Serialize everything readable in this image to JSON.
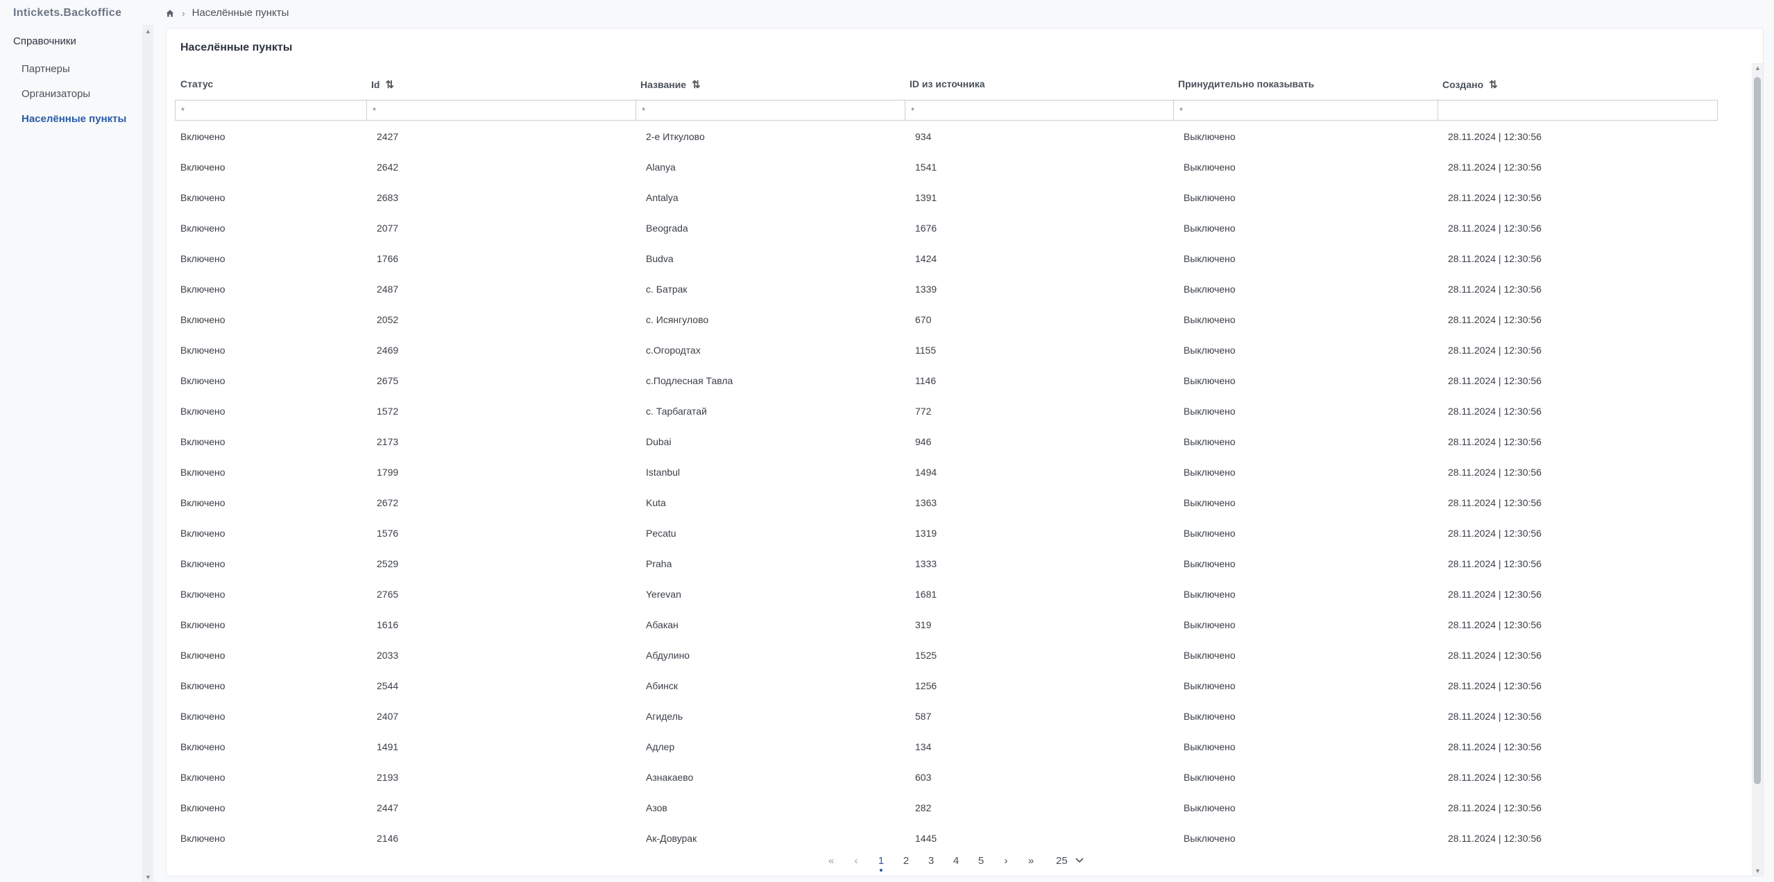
{
  "app": {
    "logo": "Intickets.Backoffice"
  },
  "breadcrumb": {
    "current": "Населённые пункты"
  },
  "sidebar": {
    "group": "Справочники",
    "items": [
      {
        "label": "Партнеры",
        "active": false
      },
      {
        "label": "Организаторы",
        "active": false
      },
      {
        "label": "Населённые пункты",
        "active": true
      }
    ]
  },
  "page": {
    "title": "Населённые пункты"
  },
  "table": {
    "columns": [
      {
        "label": "Статус",
        "sortable": false
      },
      {
        "label": "Id",
        "sortable": true
      },
      {
        "label": "Название",
        "sortable": true
      },
      {
        "label": "ID из источника",
        "sortable": false
      },
      {
        "label": "Принудительно показывать",
        "sortable": false
      },
      {
        "label": "Создано",
        "sortable": true
      }
    ],
    "filters": [
      {
        "placeholder": "*"
      },
      {
        "placeholder": "*"
      },
      {
        "placeholder": "*"
      },
      {
        "placeholder": "*"
      },
      {
        "placeholder": "*"
      },
      {
        "placeholder": ""
      }
    ],
    "rows": [
      [
        "Включено",
        "2427",
        "2-е Иткулово",
        "934",
        "Выключено",
        "28.11.2024 | 12:30:56"
      ],
      [
        "Включено",
        "2642",
        "Alanya",
        "1541",
        "Выключено",
        "28.11.2024 | 12:30:56"
      ],
      [
        "Включено",
        "2683",
        "Antalya",
        "1391",
        "Выключено",
        "28.11.2024 | 12:30:56"
      ],
      [
        "Включено",
        "2077",
        "Beograda",
        "1676",
        "Выключено",
        "28.11.2024 | 12:30:56"
      ],
      [
        "Включено",
        "1766",
        "Budva",
        "1424",
        "Выключено",
        "28.11.2024 | 12:30:56"
      ],
      [
        "Включено",
        "2487",
        "с. Батрак",
        "1339",
        "Выключено",
        "28.11.2024 | 12:30:56"
      ],
      [
        "Включено",
        "2052",
        "с. Исянгулово",
        "670",
        "Выключено",
        "28.11.2024 | 12:30:56"
      ],
      [
        "Включено",
        "2469",
        "с.Огородтах",
        "1155",
        "Выключено",
        "28.11.2024 | 12:30:56"
      ],
      [
        "Включено",
        "2675",
        "с.Подлесная Тавла",
        "1146",
        "Выключено",
        "28.11.2024 | 12:30:56"
      ],
      [
        "Включено",
        "1572",
        "с. Тарбагатай",
        "772",
        "Выключено",
        "28.11.2024 | 12:30:56"
      ],
      [
        "Включено",
        "2173",
        "Dubai",
        "946",
        "Выключено",
        "28.11.2024 | 12:30:56"
      ],
      [
        "Включено",
        "1799",
        "Istanbul",
        "1494",
        "Выключено",
        "28.11.2024 | 12:30:56"
      ],
      [
        "Включено",
        "2672",
        "Kuta",
        "1363",
        "Выключено",
        "28.11.2024 | 12:30:56"
      ],
      [
        "Включено",
        "1576",
        "Pecatu",
        "1319",
        "Выключено",
        "28.11.2024 | 12:30:56"
      ],
      [
        "Включено",
        "2529",
        "Praha",
        "1333",
        "Выключено",
        "28.11.2024 | 12:30:56"
      ],
      [
        "Включено",
        "2765",
        "Yerevan",
        "1681",
        "Выключено",
        "28.11.2024 | 12:30:56"
      ],
      [
        "Включено",
        "1616",
        "Абакан",
        "319",
        "Выключено",
        "28.11.2024 | 12:30:56"
      ],
      [
        "Включено",
        "2033",
        "Абдулино",
        "1525",
        "Выключено",
        "28.11.2024 | 12:30:56"
      ],
      [
        "Включено",
        "2544",
        "Абинск",
        "1256",
        "Выключено",
        "28.11.2024 | 12:30:56"
      ],
      [
        "Включено",
        "2407",
        "Агидель",
        "587",
        "Выключено",
        "28.11.2024 | 12:30:56"
      ],
      [
        "Включено",
        "1491",
        "Адлер",
        "134",
        "Выключено",
        "28.11.2024 | 12:30:56"
      ],
      [
        "Включено",
        "2193",
        "Азнакаево",
        "603",
        "Выключено",
        "28.11.2024 | 12:30:56"
      ],
      [
        "Включено",
        "2447",
        "Азов",
        "282",
        "Выключено",
        "28.11.2024 | 12:30:56"
      ],
      [
        "Включено",
        "2146",
        "Ак-Довурак",
        "1445",
        "Выключено",
        "28.11.2024 | 12:30:56"
      ]
    ]
  },
  "pagination": {
    "first": "«",
    "prev": "‹",
    "pages": [
      "1",
      "2",
      "3",
      "4",
      "5"
    ],
    "current": "1",
    "next": "›",
    "last": "»",
    "per_page": "25"
  },
  "colors": {
    "accent": "#2a5ba8"
  }
}
